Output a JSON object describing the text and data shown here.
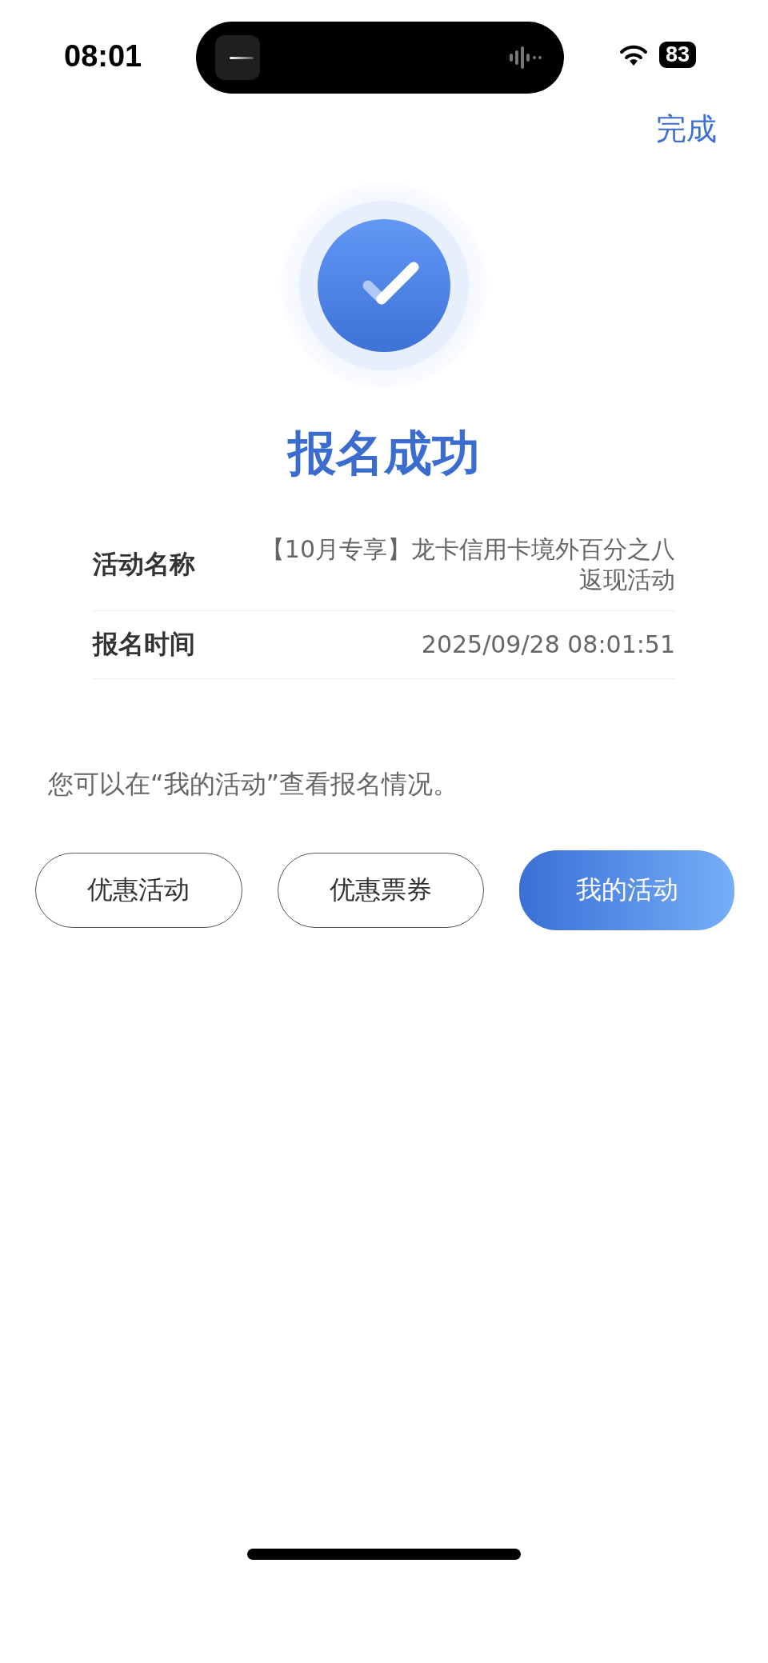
{
  "status_bar": {
    "time": "08:01",
    "battery": "83"
  },
  "nav": {
    "done": "完成"
  },
  "result": {
    "title": "报名成功"
  },
  "details": [
    {
      "label": "活动名称",
      "value": "【10月专享】龙卡信用卡境外百分之八返现活动"
    },
    {
      "label": "报名时间",
      "value": "2025/09/28  08:01:51"
    }
  ],
  "note": "您可以在“我的活动”查看报名情况。",
  "buttons": [
    {
      "label": "优惠活动",
      "kind": "outline"
    },
    {
      "label": "优惠票券",
      "kind": "outline"
    },
    {
      "label": "我的活动",
      "kind": "primary"
    }
  ]
}
